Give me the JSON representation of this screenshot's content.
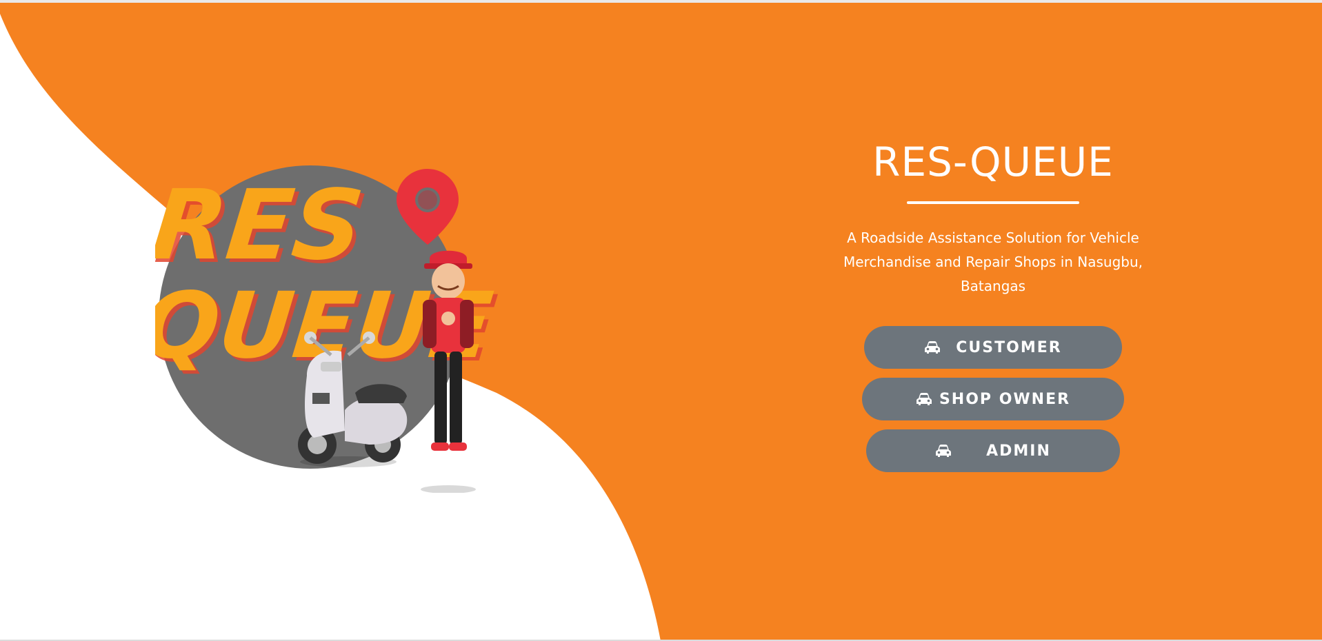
{
  "hero": {
    "logo_line1": "RES",
    "logo_line2": "QUEUE",
    "pin_icon": "location-pin-icon",
    "scooter_icon": "scooter-illustration",
    "rider_icon": "delivery-rider-illustration"
  },
  "header": {
    "title": "RES-QUEUE",
    "subtitle": "A Roadside Assistance Solution for Vehicle Merchandise and Repair Shops in Nasugbu, Batangas"
  },
  "buttons": [
    {
      "label": "CUSTOMER",
      "icon": "car-icon"
    },
    {
      "label": "SHOP OWNER",
      "icon": "car-icon"
    },
    {
      "label": "ADMIN",
      "icon": "car-icon"
    }
  ],
  "colors": {
    "accent": "#f58220",
    "button": "#6d757c",
    "logo_yellow": "#f9a51a",
    "circle_gray": "#6e6e6e",
    "pin_red": "#e8323c"
  }
}
